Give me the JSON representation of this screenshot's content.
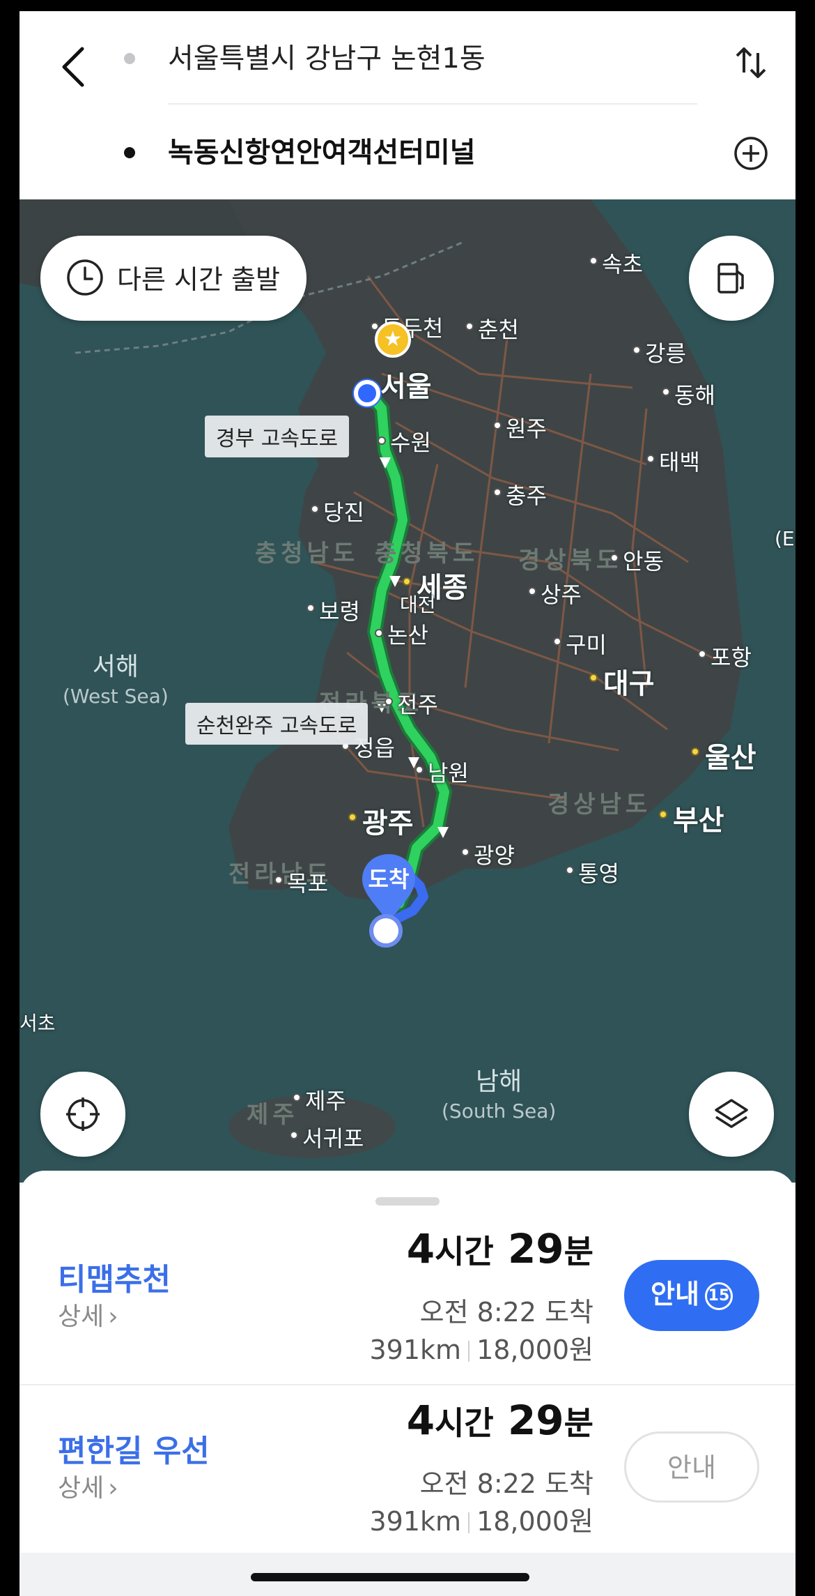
{
  "header": {
    "origin": "서울특별시 강남구 논현1동",
    "destination": "녹동신항연안여객선터미널"
  },
  "map": {
    "depart_time_button": "다른 시간 출발",
    "road_tags": [
      "경부 고속도로",
      "순천완주 고속도로"
    ],
    "dest_pin_label": "도착",
    "cities": [
      {
        "name": "속초"
      },
      {
        "name": "동두천"
      },
      {
        "name": "춘천"
      },
      {
        "name": "강릉"
      },
      {
        "name": "서울"
      },
      {
        "name": "동해"
      },
      {
        "name": "수원"
      },
      {
        "name": "원주"
      },
      {
        "name": "태백"
      },
      {
        "name": "충주"
      },
      {
        "name": "당진"
      },
      {
        "name": "안동"
      },
      {
        "name": "세종"
      },
      {
        "name": "대전"
      },
      {
        "name": "상주"
      },
      {
        "name": "보령"
      },
      {
        "name": "논산"
      },
      {
        "name": "구미"
      },
      {
        "name": "포항"
      },
      {
        "name": "대구"
      },
      {
        "name": "전주"
      },
      {
        "name": "정읍"
      },
      {
        "name": "울산"
      },
      {
        "name": "남원"
      },
      {
        "name": "광주"
      },
      {
        "name": "부산"
      },
      {
        "name": "광양"
      },
      {
        "name": "통영"
      },
      {
        "name": "목포"
      },
      {
        "name": "제주"
      },
      {
        "name": "서귀포"
      }
    ],
    "regions": [
      "충청남도",
      "충청북도",
      "경상북도",
      "경상남도",
      "전라북도",
      "전라남도",
      "제주"
    ],
    "seas": {
      "west": {
        "name": "서해",
        "en": "(West Sea)"
      },
      "south": {
        "name": "남해",
        "en": "(South Sea)"
      }
    },
    "edge_labels": [
      "(Ea",
      "서초"
    ]
  },
  "routes": [
    {
      "name": "티맵추천",
      "detail": "상세",
      "time_hours": "4",
      "time_hours_unit": "시간",
      "time_minutes": "29",
      "time_minutes_unit": "분",
      "eta": "오전 8:22 도착",
      "distance": "391km",
      "toll": "18,000원",
      "guide_label": "안내",
      "guide_badge": "15"
    },
    {
      "name": "편한길 우선",
      "detail": "상세",
      "time_hours": "4",
      "time_hours_unit": "시간",
      "time_minutes": "29",
      "time_minutes_unit": "분",
      "eta": "오전 8:22 도착",
      "distance": "391km",
      "toll": "18,000원",
      "guide_label": "안내"
    }
  ]
}
